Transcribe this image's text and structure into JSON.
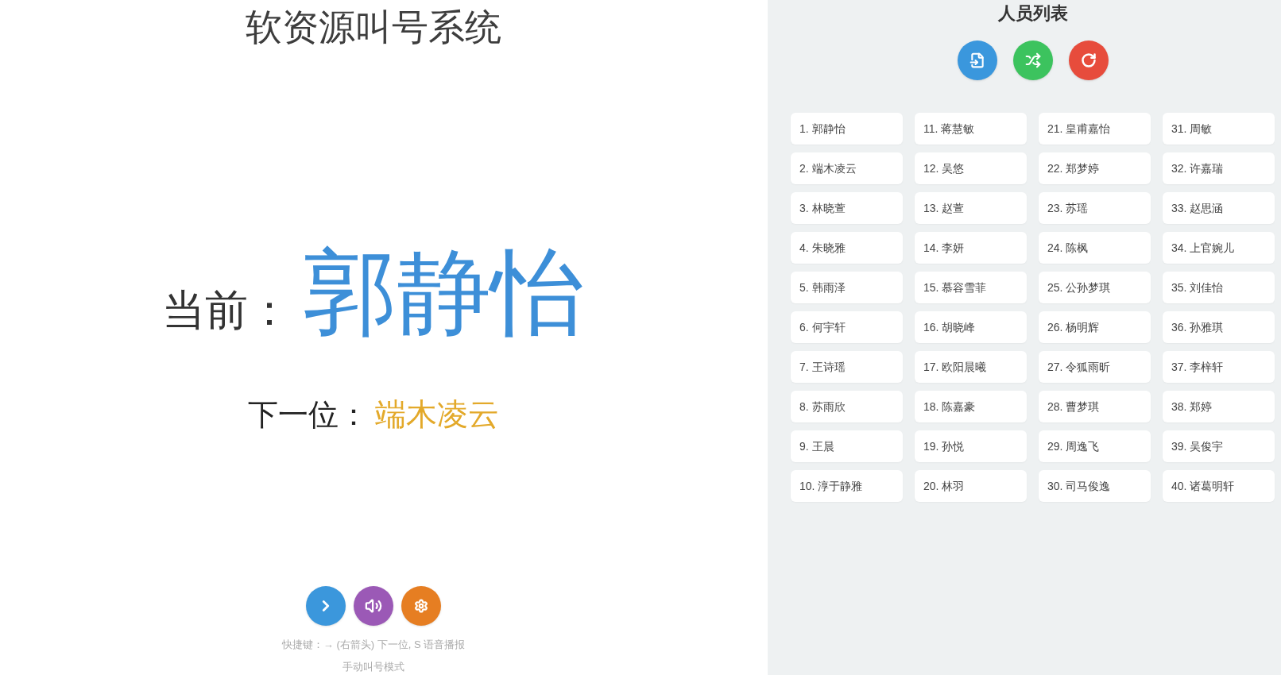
{
  "caller": {
    "title": "软资源叫号系统",
    "current": {
      "label": "当前：",
      "name": "郭静怡"
    },
    "next": {
      "label": "下一位：",
      "name": "端木凌云"
    },
    "buttons": [
      {
        "kind": "next"
      },
      {
        "kind": "speak"
      },
      {
        "kind": "settings"
      }
    ],
    "shortcut_hint": "快捷键：→ (右箭头) 下一位, S 语音播报",
    "mode": "手动叫号模式"
  },
  "roster": {
    "title": "人员列表",
    "buttons": [
      {
        "kind": "import"
      },
      {
        "kind": "shuffle"
      },
      {
        "kind": "reset"
      }
    ],
    "people": [
      "1. 郭静怡",
      "2. 端木凌云",
      "3. 林晓萱",
      "4. 朱晓雅",
      "5. 韩雨泽",
      "6. 何宇轩",
      "7. 王诗瑶",
      "8. 苏雨欣",
      "9. 王晨",
      "10. 淳于静雅",
      "11. 蒋慧敏",
      "12. 吴悠",
      "13. 赵萱",
      "14. 李妍",
      "15. 慕容雪菲",
      "16. 胡晓峰",
      "17. 欧阳晨曦",
      "18. 陈嘉豪",
      "19. 孙悦",
      "20. 林羽",
      "21. 皇甫嘉怡",
      "22. 郑梦婷",
      "23. 苏瑶",
      "24. 陈枫",
      "25. 公孙梦琪",
      "26. 杨明辉",
      "27. 令狐雨昕",
      "28. 曹梦琪",
      "29. 周逸飞",
      "30. 司马俊逸",
      "31. 周敏",
      "32. 许嘉瑞",
      "33. 赵思涵",
      "34. 上官婉儿",
      "35. 刘佳怡",
      "36. 孙雅琪",
      "37. 李梓轩",
      "38. 郑婷",
      "39. 吴俊宇",
      "40. 诸葛明轩"
    ]
  }
}
